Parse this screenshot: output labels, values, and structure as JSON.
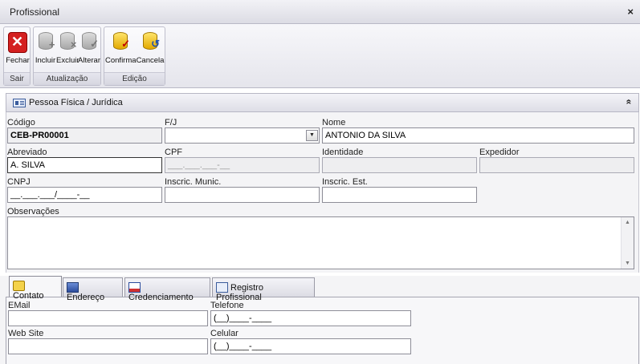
{
  "window": {
    "title": "Profissional",
    "close_glyph": "×"
  },
  "ribbon": {
    "groups": [
      {
        "caption": "Sair",
        "buttons": [
          {
            "label": "Fechar",
            "icon": "close-red-icon"
          }
        ]
      },
      {
        "caption": "Atualização",
        "buttons": [
          {
            "label": "Incluir",
            "icon": "database-add-icon"
          },
          {
            "label": "Excluir",
            "icon": "database-delete-icon"
          },
          {
            "label": "Alterar",
            "icon": "database-edit-icon"
          }
        ]
      },
      {
        "caption": "Edição",
        "buttons": [
          {
            "label": "Confirma",
            "icon": "database-confirm-icon"
          },
          {
            "label": "Cancela",
            "icon": "database-cancel-icon"
          }
        ]
      }
    ]
  },
  "section": {
    "title": "Pessoa Física / Jurídica",
    "collapse_glyph": "«"
  },
  "form": {
    "codigo": {
      "label": "Código",
      "value": "CEB-PR00001"
    },
    "fj": {
      "label": "F/J",
      "value": ""
    },
    "nome": {
      "label": "Nome",
      "value": "ANTONIO DA SILVA"
    },
    "abreviado": {
      "label": "Abreviado",
      "value": "A. SILVA"
    },
    "cpf": {
      "label": "CPF",
      "value": "___.___.___-__"
    },
    "identidade": {
      "label": "Identidade",
      "value": ""
    },
    "expedidor": {
      "label": "Expedidor",
      "value": ""
    },
    "cnpj": {
      "label": "CNPJ",
      "value": "__.___.___/____-__"
    },
    "inscr_munic": {
      "label": "Inscric. Munic.",
      "value": ""
    },
    "inscr_est": {
      "label": "Inscric. Est.",
      "value": ""
    },
    "observacoes": {
      "label": "Observações",
      "value": ""
    }
  },
  "tabs": [
    {
      "label": "Contato",
      "icon": "contact-icon",
      "active": true
    },
    {
      "label": "Endereço",
      "icon": "building-icon",
      "active": false
    },
    {
      "label": "Credenciamento",
      "icon": "document-icon",
      "active": false
    },
    {
      "label": "Registro Profissional",
      "icon": "id-card-icon",
      "active": false
    }
  ],
  "contato": {
    "email": {
      "label": "EMail",
      "value": ""
    },
    "telefone": {
      "label": "Telefone",
      "value": "(__)____-____"
    },
    "website": {
      "label": "Web Site",
      "value": ""
    },
    "celular": {
      "label": "Celular",
      "value": "(__)____-____"
    }
  }
}
